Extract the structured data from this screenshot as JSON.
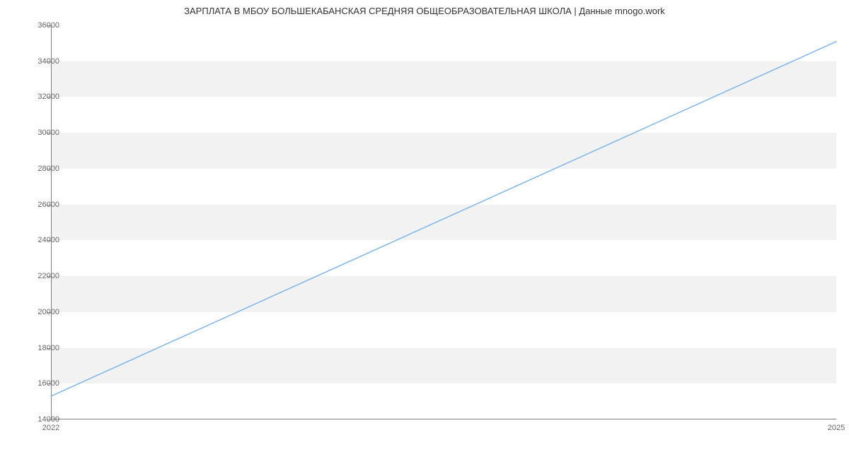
{
  "chart_data": {
    "type": "line",
    "title": "ЗАРПЛАТА В МБОУ БОЛЬШЕКАБАНСКАЯ СРЕДНЯЯ ОБЩЕОБРАЗОВАТЕЛЬНАЯ ШКОЛА | Данные mnogo.work",
    "x": [
      2022,
      2025
    ],
    "values": [
      15300,
      35100
    ],
    "xlabel": "",
    "ylabel": "",
    "xlim": [
      2022,
      2025
    ],
    "ylim": [
      14000,
      36000
    ],
    "y_ticks": [
      14000,
      16000,
      18000,
      20000,
      22000,
      24000,
      26000,
      28000,
      30000,
      32000,
      34000,
      36000
    ],
    "x_ticks": [
      2022,
      2025
    ],
    "line_color": "#7cb5ec",
    "grid": true
  }
}
